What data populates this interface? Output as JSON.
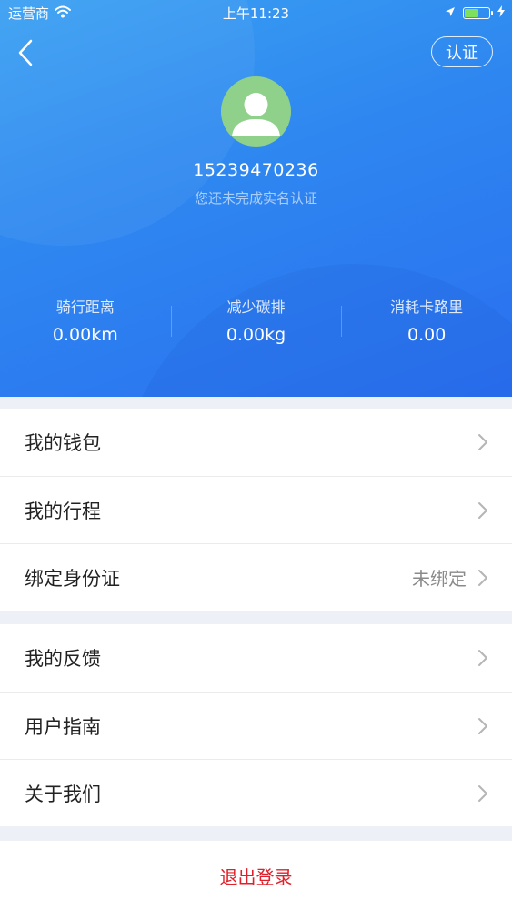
{
  "status_bar": {
    "carrier": "运营商",
    "time": "上午11:23"
  },
  "header": {
    "auth_button": "认证",
    "phone": "15239470236",
    "verify_note": "您还未完成实名认证",
    "stats": [
      {
        "label": "骑行距离",
        "value": "0.00km"
      },
      {
        "label": "减少碳排",
        "value": "0.00kg"
      },
      {
        "label": "消耗卡路里",
        "value": "0.00"
      }
    ]
  },
  "menu_group_1": [
    {
      "label": "我的钱包",
      "value": ""
    },
    {
      "label": "我的行程",
      "value": ""
    },
    {
      "label": "绑定身份证",
      "value": "未绑定"
    }
  ],
  "menu_group_2": [
    {
      "label": "我的反馈"
    },
    {
      "label": "用户指南"
    },
    {
      "label": "关于我们"
    }
  ],
  "logout_label": "退出登录",
  "colors": {
    "header_blue": "#2e86f0",
    "avatar_green": "#8fd18b",
    "logout_red": "#e0202a",
    "battery_green": "#7ee05c"
  },
  "icons": [
    "wifi-icon",
    "location-arrow-icon",
    "battery-icon",
    "charging-bolt-icon",
    "back-chevron-icon",
    "avatar-person-icon",
    "chevron-right-icon"
  ]
}
